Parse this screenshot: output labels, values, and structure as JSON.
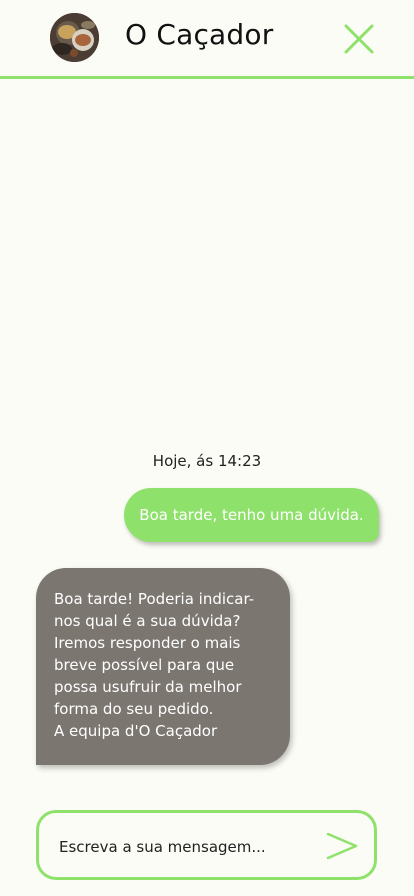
{
  "header": {
    "title": "O Caçador",
    "accent_color": "#8ee26b",
    "avatar_icon": "food-photo-avatar",
    "close_icon": "close-icon"
  },
  "chat": {
    "timestamp": "Hoje, ás 14:23",
    "messages": [
      {
        "from": "user",
        "text": "Boa tarde, tenho uma dúvida."
      },
      {
        "from": "business",
        "lines": [
          "Boa tarde! Poderia indicar-",
          "nos qual é a sua dúvida?",
          "Iremos responder o mais",
          "breve possível para que",
          "possa usufruir da melhor",
          "forma do seu pedido.",
          "A equipa d'O Caçador"
        ]
      }
    ]
  },
  "composer": {
    "placeholder": "Escreva a sua mensagem...",
    "value": "",
    "send_icon": "send-icon"
  }
}
